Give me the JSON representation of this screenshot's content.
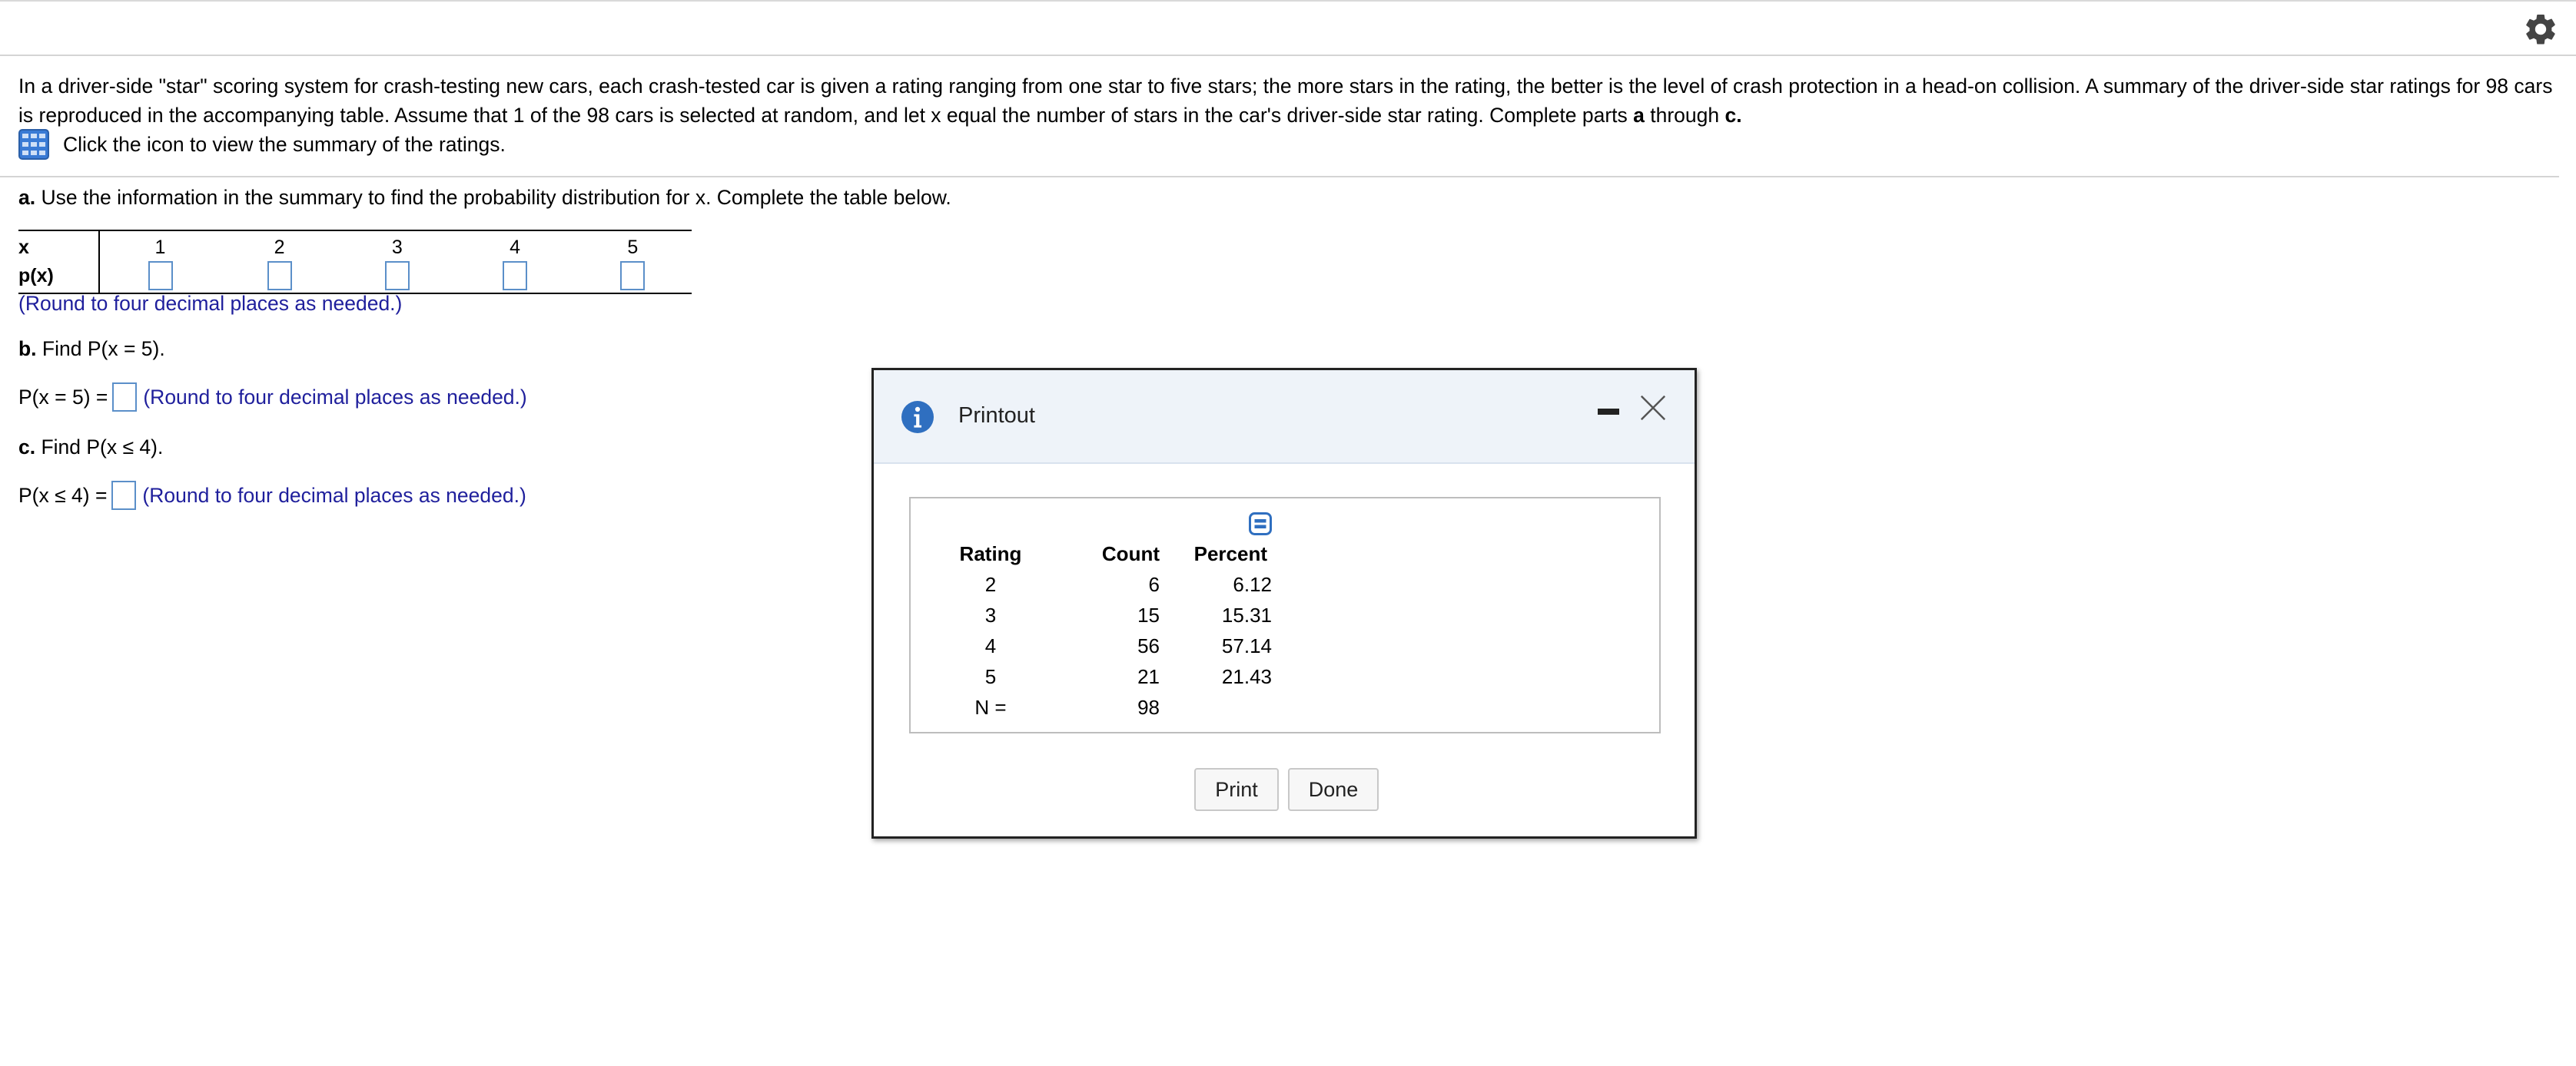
{
  "intro": {
    "part1": "In a driver-side \"star\" scoring system for crash-testing new cars, each crash-tested car is given a rating ranging from one star to five stars; the more stars in the rating, the better is the level of crash protection in a head-on collision. A summary of the driver-side star ratings for 98 cars is reproduced in the accompanying table. Assume that 1 of the 98 cars is selected at random, and let x equal the number of stars in the car's driver-side star rating. Complete parts ",
    "bold_a": "a",
    "through": " through ",
    "bold_c": "c."
  },
  "icon_hint": "Click the icon to view the summary of the ratings.",
  "part_a": {
    "label": "a.",
    "text": " Use the information in the summary to find the probability distribution for x. Complete the table below.",
    "row_x_label": "x",
    "row_p_label": "p(x)",
    "x_values": [
      "1",
      "2",
      "3",
      "4",
      "5"
    ],
    "round_note": "(Round to four decimal places as needed.)"
  },
  "part_b": {
    "label": "b.",
    "text": " Find P(x = 5).",
    "lhs": "P(x = 5) =",
    "round_note": "(Round to four decimal places as needed.)"
  },
  "part_c": {
    "label": "c.",
    "text": " Find P(x ≤ 4).",
    "lhs": "P(x ≤ 4) =",
    "round_note": "(Round to four decimal places as needed.)"
  },
  "dialog": {
    "title": "Printout",
    "columns": [
      "Rating",
      "Count",
      "Percent"
    ],
    "rows": [
      {
        "rating": "2",
        "count": "6",
        "percent": "6.12"
      },
      {
        "rating": "3",
        "count": "15",
        "percent": "15.31"
      },
      {
        "rating": "4",
        "count": "56",
        "percent": "57.14"
      },
      {
        "rating": "5",
        "count": "21",
        "percent": "21.43"
      }
    ],
    "total_label": "N =",
    "total_value": "98",
    "print_label": "Print",
    "done_label": "Done"
  },
  "colors": {
    "accent_blue": "#2f6fc0",
    "round_note_text": "#1f1f9c",
    "input_border": "#5b8fc9"
  }
}
